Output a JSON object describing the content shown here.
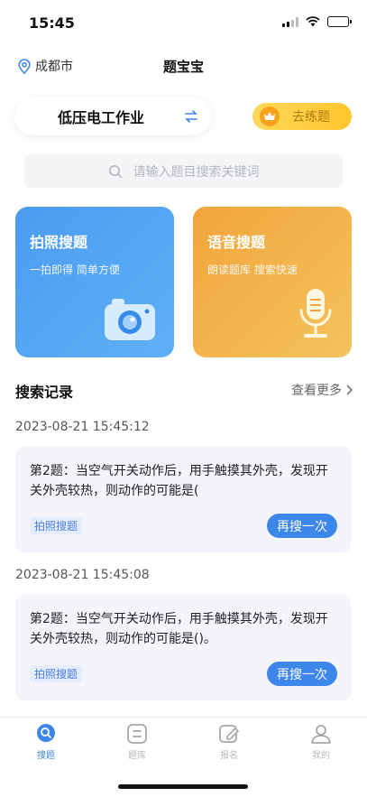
{
  "status_bar": {
    "time": "15:45"
  },
  "header": {
    "location": "成都市",
    "title": "题宝宝"
  },
  "subject": {
    "name": "低压电工作业"
  },
  "practice": {
    "label": "去练题"
  },
  "search": {
    "placeholder": "请输入题目搜索关键词"
  },
  "cards": {
    "photo": {
      "title": "拍照搜题",
      "subtitle": "一拍即得 简单方便"
    },
    "voice": {
      "title": "语音搜题",
      "subtitle": "朗读题库 搜索快速"
    }
  },
  "history": {
    "title": "搜索记录",
    "more": "查看更多",
    "records": [
      {
        "time": "2023-08-21 15:45:12",
        "question": "第2题：当空气开关动作后，用手触摸其外壳，发现开关外壳较热，则动作的可能是(",
        "tag": "拍照搜题",
        "action": "再搜一次"
      },
      {
        "time": "2023-08-21 15:45:08",
        "question": "第2题：当空气开关动作后，用手触摸其外壳，发现开关外壳较热，则动作的可能是()。",
        "tag": "拍照搜题",
        "action": "再搜一次"
      }
    ]
  },
  "tabbar": {
    "items": [
      {
        "label": "搜题",
        "icon": "search-icon",
        "active": true
      },
      {
        "label": "题库",
        "icon": "list-icon",
        "active": false
      },
      {
        "label": "报名",
        "icon": "edit-icon",
        "active": false
      },
      {
        "label": "我的",
        "icon": "user-icon",
        "active": false
      }
    ]
  },
  "colors": {
    "accent": "#3d86ea",
    "photo_card": "#4b9cf0",
    "voice_card": "#f0a53c",
    "practice": "#ffc52e"
  }
}
